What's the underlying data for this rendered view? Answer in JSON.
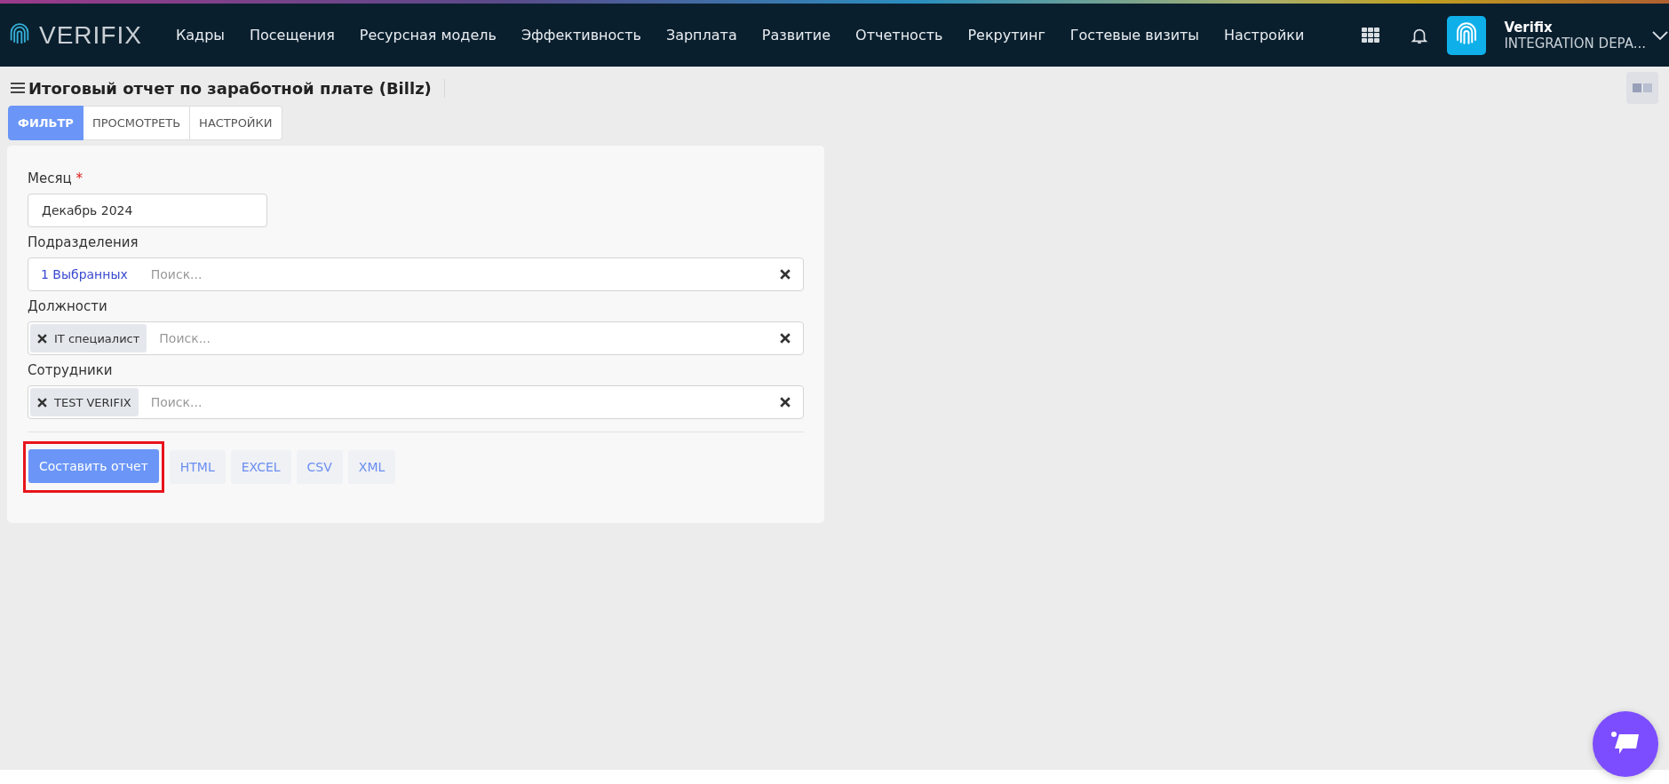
{
  "header": {
    "brand": "VERIFIX",
    "nav": [
      "Кадры",
      "Посещения",
      "Ресурсная модель",
      "Эффективность",
      "Зарплата",
      "Развитие",
      "Отчетность",
      "Рекрутинг",
      "Гостевые визиты",
      "Настройки"
    ],
    "user": {
      "name": "Verifix",
      "org": "INTEGRATION DEPA..."
    }
  },
  "page": {
    "title": "Итоговый отчет по заработной плате (Billz)"
  },
  "tabs": [
    {
      "label": "ФИЛЬТР",
      "selected": true
    },
    {
      "label": "ПРОСМОТРЕТЬ",
      "selected": false
    },
    {
      "label": "НАСТРОЙКИ",
      "selected": false
    }
  ],
  "form": {
    "required_mark": "*",
    "fields": [
      {
        "kind": "text",
        "label": "Месяц",
        "required": true,
        "value": "Декабрь 2024"
      },
      {
        "kind": "multiselect",
        "label": "Подразделения",
        "required": false,
        "summary": "1 Выбранных",
        "placeholder": "Поиск..."
      },
      {
        "kind": "multiselect",
        "label": "Должности",
        "required": false,
        "tags": [
          "IT специалист"
        ],
        "placeholder": "Поиск..."
      },
      {
        "kind": "multiselect",
        "label": "Сотрудники",
        "required": false,
        "tags": [
          "TEST VERIFIX"
        ],
        "placeholder": "Поиск..."
      }
    ],
    "actions": [
      {
        "label": "Составить отчет",
        "kind": "primary",
        "highlighted": true
      },
      {
        "label": "HTML",
        "kind": "export",
        "highlighted": false
      },
      {
        "label": "EXCEL",
        "kind": "export",
        "highlighted": false
      },
      {
        "label": "CSV",
        "kind": "export",
        "highlighted": false
      },
      {
        "label": "XML",
        "kind": "export",
        "highlighted": false
      }
    ]
  }
}
